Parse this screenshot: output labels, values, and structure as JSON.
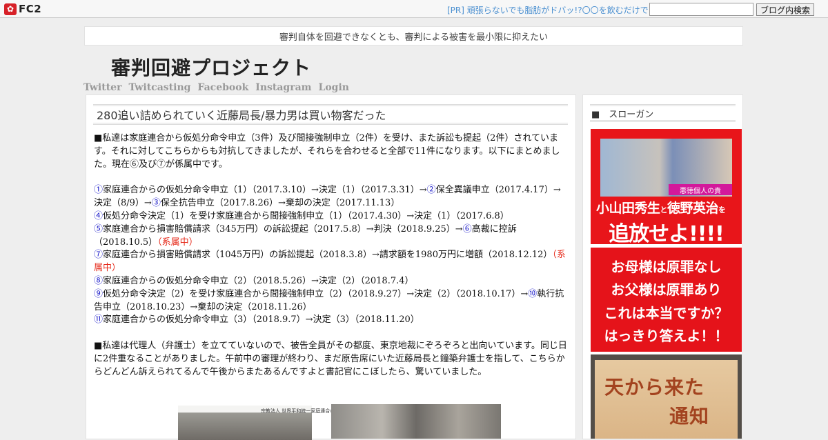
{
  "topbar": {
    "logo_text": "FC2",
    "pr_link": "[PR] 頑張らないでも脂肪がドバッ!?〇〇を飲むだけで",
    "search_value": "",
    "search_button": "ブログ内検索"
  },
  "header": {
    "tagline": "審判自体を回避できなくとも、審判による被害を最小限に抑えたい",
    "title": "審判回避プロジェクト",
    "nav": [
      "Twitter",
      "Twitcasting",
      "Facebook",
      "Instagram",
      "Login"
    ]
  },
  "post": {
    "title": "280追い詰められていく近藤局長/暴力男は買い物客だった",
    "intro": "■私達は家庭連合から仮処分命令申立（3件）及び間接強制申立（2件）を受け、また訴訟も提起（2件）されています。それに対してこちらからも対抗してきましたが、それらを合わせると全部で11件になります。以下にまとめました。現在⑥及び⑦が係属中です。",
    "items": [
      {
        "n1": "①",
        "t1": "家庭連合からの仮処分命令申立（1）（2017.3.10）→決定（1）（2017.3.31）→",
        "n2": "②",
        "t2": "保全異議申立（2017.4.17）→決定（8/9）→",
        "n3": "③",
        "t3": "保全抗告申立（2017.8.26）→棄却の決定（2017.11.13）"
      },
      {
        "n1": "④",
        "t1": "仮処分命令決定（1）を受け家庭連合から間接強制申立（1）（2017.4.30）→決定（1）（2017.6.8）"
      },
      {
        "n1": "⑤",
        "t1": "家庭連合から損害賠償請求（345万円）の訴訟提起（2017.5.8）→判決（2018.9.25）→",
        "n2": "⑥",
        "t2": "高裁に控訴（2018.10.5）",
        "status": "（系属中）"
      },
      {
        "n1": "⑦",
        "t1": "家庭連合から損害賠償請求（1045万円）の訴訟提起（2018.3.8）→請求額を1980万円に増額（2018.12.12）",
        "status": "（系属中）"
      },
      {
        "n1": "⑧",
        "t1": "家庭連合からの仮処分命令申立（2）（2018.5.26）→決定（2）（2018.7.4）"
      },
      {
        "n1": "⑨",
        "t1": "仮処分命令決定（2）を受け家庭連合から間接強制申立（2）（2018.9.27）→決定（2）（2018.10.17）→",
        "n2": "⑩",
        "t2": "執行抗告申立（2018.10.23）→棄却の決定（2018.11.26）"
      },
      {
        "n1": "⑪",
        "t1": "家庭連合からの仮処分命令申立（3）（2018.9.7）→決定（3）（2018.11.20）"
      }
    ],
    "para2": "■私達は代理人（弁護士）を立てていないので、被告全員がその都度、東京地裁にぞろぞろと出向いています。同じ日に2件重なることがありました。午前中の審理が終わり、まだ原告席にいた近藤局長と鐘築弁護士を指して、こちらからどんどん訴えられてるんで午後からまたあるんですよと書記官にこぼしたら、驚いていました。",
    "photo_label": "宗教法人 世界平和統一家庭連合の玄関"
  },
  "sidebar": {
    "heading": "■　スローガン",
    "banner1": {
      "photo_caption": "悪徳個人の責",
      "line1_a": "小山田秀生",
      "line1_b": "と",
      "line1_c": "徳野英治",
      "line1_d": "を",
      "line2": "追放せよ!!!!"
    },
    "banner2": {
      "lines": [
        "お母様は原罪なし",
        "お父様は原罪あり",
        "これは本当ですか？",
        "はっきり答えよ！！"
      ]
    },
    "banner3": {
      "line1": "天から来た",
      "line2": "通知"
    }
  }
}
